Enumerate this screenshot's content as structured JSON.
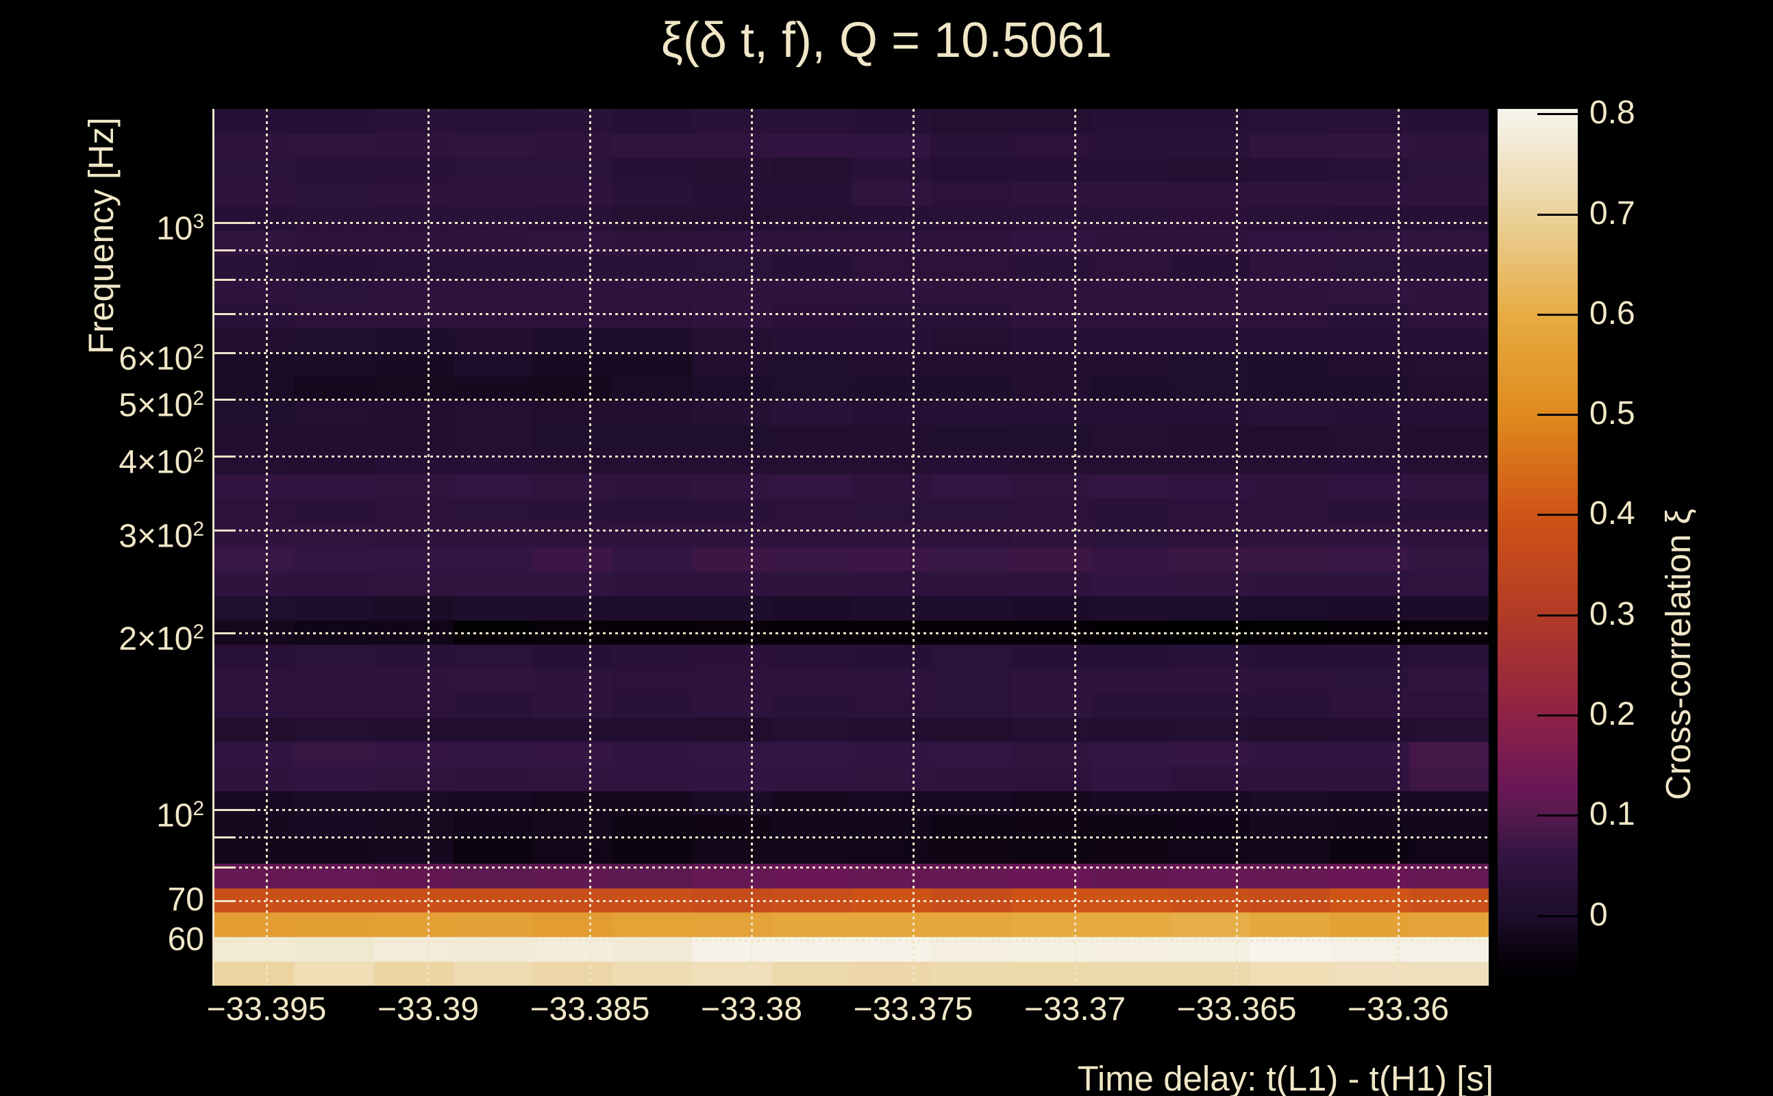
{
  "title": "ξ(δ t, f), Q = 10.5061",
  "colors": {
    "background": "#000000",
    "text": "#f1e7c8",
    "grid": "#efe5c9",
    "axis_line": "#efe5c9",
    "colorbar_tick": "#000000"
  },
  "y_axis": {
    "title": "Frequency [Hz]",
    "ticks": [
      {
        "label": "10^3",
        "f": 1000,
        "major": true
      },
      {
        "label": "6×10^2",
        "f": 600,
        "major": false
      },
      {
        "label": "5×10^2",
        "f": 500,
        "major": false
      },
      {
        "label": "4×10^2",
        "f": 400,
        "major": false
      },
      {
        "label": "3×10^2",
        "f": 300,
        "major": false
      },
      {
        "label": "2×10^2",
        "f": 200,
        "major": false
      },
      {
        "label": "10^2",
        "f": 100,
        "major": true
      },
      {
        "label": "70",
        "f": 70,
        "major": false
      },
      {
        "label": "60",
        "f": 60,
        "major": false
      }
    ]
  },
  "x_axis": {
    "title": "Time delay: t(L1) - t(H1) [s]",
    "ticks": [
      {
        "label": "−33.395",
        "t": -33.395
      },
      {
        "label": "−33.39",
        "t": -33.39
      },
      {
        "label": "−33.385",
        "t": -33.385
      },
      {
        "label": "−33.38",
        "t": -33.38
      },
      {
        "label": "−33.375",
        "t": -33.375
      },
      {
        "label": "−33.37",
        "t": -33.37
      },
      {
        "label": "−33.365",
        "t": -33.365
      },
      {
        "label": "−33.36",
        "t": -33.36
      }
    ]
  },
  "colorbar": {
    "title": "Cross-correlation ξ",
    "v_top": 0.805,
    "v_bottom": -0.07,
    "ticks": [
      {
        "label": "0.8",
        "v": 0.8
      },
      {
        "label": "0.7",
        "v": 0.7
      },
      {
        "label": "0.6",
        "v": 0.6
      },
      {
        "label": "0.5",
        "v": 0.5
      },
      {
        "label": "0.4",
        "v": 0.4
      },
      {
        "label": "0.3",
        "v": 0.3
      },
      {
        "label": "0.2",
        "v": 0.2
      },
      {
        "label": "0.1",
        "v": 0.1
      },
      {
        "label": "0",
        "v": 0.0
      }
    ]
  },
  "chart_data": {
    "type": "heatmap",
    "title": "ξ(δ t, f), Q = 10.5061",
    "xlabel": "Time delay: t(L1) - t(H1) [s]",
    "ylabel": "Frequency [Hz]",
    "zlabel": "Cross-correlation ξ",
    "x_range": [
      -33.3966,
      -33.3572
    ],
    "f_range": [
      50.2,
      1563.3
    ],
    "log_y": true,
    "grid_on": true,
    "grid_freqs": [
      60,
      70,
      80,
      90,
      100,
      200,
      300,
      400,
      500,
      600,
      700,
      800,
      900,
      1000
    ],
    "colormap_stops": [
      [
        -0.07,
        "#000000"
      ],
      [
        -0.045,
        "#070109"
      ],
      [
        0.0,
        "#1e0d2c"
      ],
      [
        0.03,
        "#271036"
      ],
      [
        0.06,
        "#331543"
      ],
      [
        0.1,
        "#571a4f"
      ],
      [
        0.13,
        "#6b1757"
      ],
      [
        0.2,
        "#8f2246"
      ],
      [
        0.3,
        "#b23b26"
      ],
      [
        0.4,
        "#cf5417"
      ],
      [
        0.5,
        "#e08a1e"
      ],
      [
        0.6,
        "#e6ac42"
      ],
      [
        0.7,
        "#ebd29c"
      ],
      [
        0.78,
        "#f3eddc"
      ],
      [
        0.805,
        "#f7f4ee"
      ]
    ],
    "n_cols": 16,
    "texture_jitter_dark": 0.007,
    "texture_jitter_mid": 0.01,
    "texture_jitter_bright": 0.016,
    "rows": [
      {
        "f0": 50.2,
        "f1": 55.2,
        "v0": 0.72,
        "v1": 0.735
      },
      {
        "f0": 55.2,
        "f1": 60.8,
        "v0": 0.775,
        "v1": 0.8
      },
      {
        "f0": 60.8,
        "f1": 66.9,
        "v0": 0.545,
        "v1": 0.615
      },
      {
        "f0": 66.9,
        "f1": 73.6,
        "v0": 0.375,
        "v1": 0.385
      },
      {
        "f0": 73.6,
        "f1": 81.0,
        "v0": 0.115,
        "v1": 0.125
      },
      {
        "f0": 81.0,
        "f1": 89.1,
        "v0": -0.03,
        "v1": -0.03
      },
      {
        "f0": 89.1,
        "f1": 98.0,
        "v0": -0.025,
        "v1": -0.025
      },
      {
        "f0": 98.0,
        "f1": 107.8,
        "v0": -0.012,
        "v1": -0.012
      },
      {
        "f0": 107.8,
        "f1": 118.6,
        "v0": 0.05,
        "v1": 0.05
      },
      {
        "f0": 118.6,
        "f1": 130.5,
        "v0": 0.058,
        "v1": 0.058
      },
      {
        "f0": 130.5,
        "f1": 143.6,
        "v0": 0.015,
        "v1": 0.015
      },
      {
        "f0": 143.6,
        "f1": 158.0,
        "v0": 0.04,
        "v1": 0.04
      },
      {
        "f0": 158.0,
        "f1": 173.8,
        "v0": 0.046,
        "v1": 0.046
      },
      {
        "f0": 173.8,
        "f1": 191.2,
        "v0": 0.034,
        "v1": 0.034
      },
      {
        "f0": 191.2,
        "f1": 210.4,
        "v0": -0.05,
        "v1": -0.05
      },
      {
        "f0": 210.4,
        "f1": 231.5,
        "v0": 0.0,
        "v1": 0.0
      },
      {
        "f0": 231.5,
        "f1": 254.7,
        "v0": 0.05,
        "v1": 0.05
      },
      {
        "f0": 254.7,
        "f1": 280.2,
        "v0": 0.065,
        "v1": 0.065
      },
      {
        "f0": 280.2,
        "f1": 308.3,
        "v0": 0.046,
        "v1": 0.046
      },
      {
        "f0": 308.3,
        "f1": 339.2,
        "v0": 0.038,
        "v1": 0.038
      },
      {
        "f0": 339.2,
        "f1": 373.2,
        "v0": 0.052,
        "v1": 0.052
      },
      {
        "f0": 373.2,
        "f1": 410.6,
        "v0": 0.02,
        "v1": 0.02
      },
      {
        "f0": 410.6,
        "f1": 451.7,
        "v0": 0.012,
        "v1": 0.012
      },
      {
        "f0": 451.7,
        "f1": 497.0,
        "v0": 0.03,
        "v1": 0.03
      },
      {
        "f0": 497.0,
        "f1": 546.8,
        "v0": 0.004,
        "v1": 0.004
      },
      {
        "f0": 546.8,
        "f1": 601.6,
        "v0": 0.01,
        "v1": 0.01
      },
      {
        "f0": 601.6,
        "f1": 661.9,
        "v0": 0.025,
        "v1": 0.025
      },
      {
        "f0": 661.9,
        "f1": 728.2,
        "v0": 0.042,
        "v1": 0.042
      },
      {
        "f0": 728.2,
        "f1": 801.2,
        "v0": 0.047,
        "v1": 0.047
      },
      {
        "f0": 801.2,
        "f1": 881.5,
        "v0": 0.036,
        "v1": 0.036
      },
      {
        "f0": 881.5,
        "f1": 969.8,
        "v0": 0.05,
        "v1": 0.05
      },
      {
        "f0": 969.8,
        "f1": 1067.0,
        "v0": 0.032,
        "v1": 0.032
      },
      {
        "f0": 1067.0,
        "f1": 1173.9,
        "v0": 0.046,
        "v1": 0.046
      },
      {
        "f0": 1173.9,
        "f1": 1291.5,
        "v0": 0.036,
        "v1": 0.036
      },
      {
        "f0": 1291.5,
        "f1": 1420.9,
        "v0": 0.05,
        "v1": 0.05
      },
      {
        "f0": 1420.9,
        "f1": 1563.3,
        "v0": 0.035,
        "v1": 0.035
      }
    ],
    "patches": [
      {
        "t": [
          -33.3966,
          -33.3825
        ],
        "f": [
          460,
          640
        ],
        "dv": -0.018
      },
      {
        "t": [
          -33.3852,
          -33.3767
        ],
        "f": [
          950,
          1300
        ],
        "dv": -0.014
      },
      {
        "t": [
          -33.374,
          -33.3635
        ],
        "f": [
          1150,
          1520
        ],
        "dv": -0.013
      },
      {
        "t": [
          -33.3966,
          -33.39
        ],
        "f": [
          191,
          211
        ],
        "dv": 0.028
      },
      {
        "t": [
          -33.37,
          -33.3625
        ],
        "f": [
          191,
          211
        ],
        "dv": -0.012
      },
      {
        "t": [
          -33.3605,
          -33.3572
        ],
        "f": [
          104,
          132
        ],
        "dv": 0.02
      },
      {
        "t": [
          -33.361,
          -33.3572
        ],
        "f": [
          60.8,
          66.9
        ],
        "dv": -0.05
      },
      {
        "t": [
          -33.3966,
          -33.389
        ],
        "f": [
          81,
          98
        ],
        "dv": 0.008
      }
    ]
  }
}
